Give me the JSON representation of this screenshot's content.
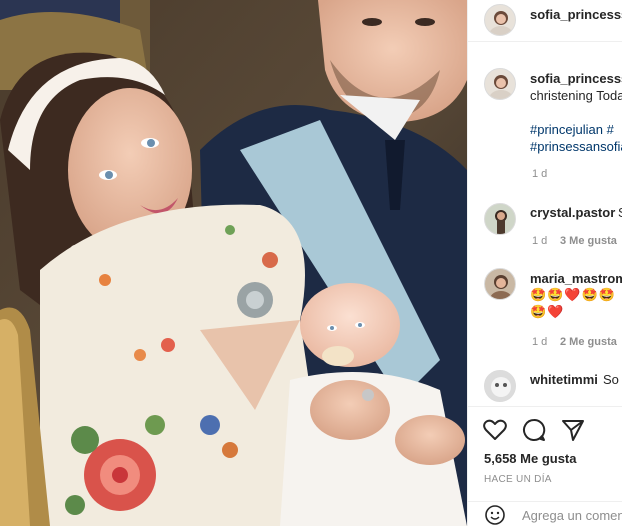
{
  "post": {
    "author": "sofia_princesssweden",
    "caption_user": "sofia_princesssweden",
    "caption_text": "christening Today",
    "hashtags_line1": "#princejulian #",
    "hashtags_line2": "#prinsessansofia",
    "caption_time": "1 d",
    "likes": "5,658 Me gusta",
    "posted_ago": "HACE UN DÍA",
    "comment_placeholder": "Agrega un comentario..."
  },
  "comments": [
    {
      "user": "crystal.pastor",
      "text": "So",
      "time": "1 d",
      "likes": "3 Me gusta",
      "emoji1": "",
      "emoji2": ""
    },
    {
      "user": "maria_mastromo",
      "text": "",
      "time": "1 d",
      "likes": "2 Me gusta",
      "emoji1": "🤩🤩❤️🤩🤩",
      "emoji2": "🤩❤️"
    },
    {
      "user": "whitetimmi",
      "text": "So",
      "time": "",
      "likes": "",
      "emoji1": "",
      "emoji2": ""
    }
  ],
  "icons": {
    "like": "heart-icon",
    "comment": "comment-bubble-icon",
    "share": "paper-plane-icon",
    "emoji": "smiley-icon"
  },
  "colors": {
    "hashtag": "#00376b",
    "meta": "#8e8e8e",
    "border": "#efefef"
  }
}
